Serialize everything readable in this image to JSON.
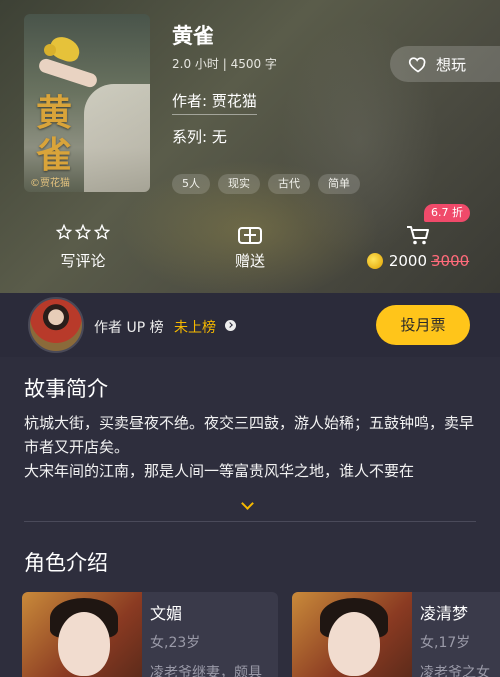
{
  "book": {
    "title": "黄雀",
    "meta": "2.0 小时 | 4500 字",
    "author_line": "作者: 贾花猫",
    "series_line": "系列: 无",
    "cover_title": "黄雀",
    "cover_author": "©贾花猫",
    "tags": [
      "5人",
      "现实",
      "古代",
      "简单"
    ]
  },
  "favorite": {
    "label": "想玩",
    "icon": "heart-outline-icon"
  },
  "actions": {
    "review_label": "写评论",
    "gift_label": "赠送",
    "discount_badge": "6.7 折",
    "price": "2000",
    "original_price": "3000"
  },
  "rank": {
    "label": "作者 UP 榜",
    "status": "未上榜",
    "vote_button": "投月票"
  },
  "intro": {
    "title": "故事简介",
    "text": "杭城大街，买卖昼夜不绝。夜交三四鼓，游人始稀；五鼓钟鸣，卖早市者又开店矣。\n大宋年间的江南，那是人间一等富贵风华之地，谁人不要在"
  },
  "roles": {
    "title": "角色介绍",
    "items": [
      {
        "name": "文媚",
        "sub": "女,23岁",
        "desc": "凌老爷继妻，颇具"
      },
      {
        "name": "凌清梦",
        "sub": "女,17岁",
        "desc": "凌老爷之女"
      }
    ]
  },
  "colors": {
    "accent": "#ffc51a",
    "discount": "#f04a6a",
    "status": "#f5b800"
  }
}
